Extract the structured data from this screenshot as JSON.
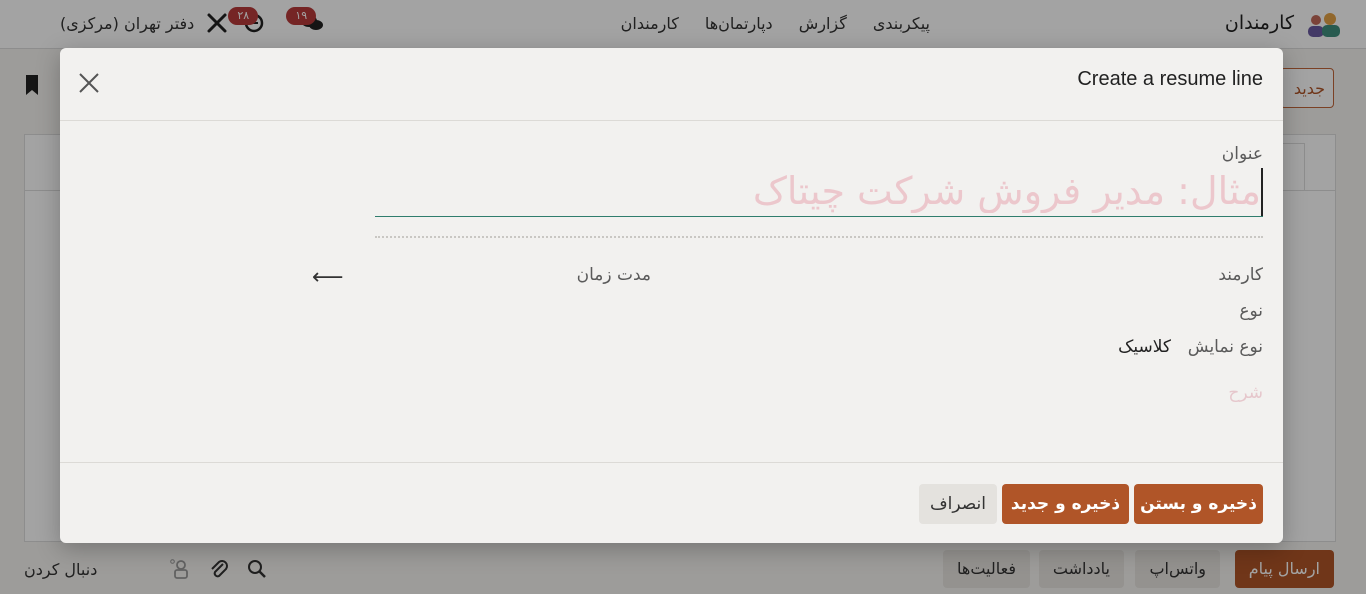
{
  "app": {
    "title": "کارمندان",
    "menu": [
      "کارمندان",
      "دپارتمان‌ها",
      "گزارش",
      "پیکربندی"
    ],
    "company": "دفتر تهران (مرکزی)",
    "messages_badge": "۱۹",
    "activities_badge": "۲۸",
    "new_button_label": "جدید",
    "brand_color": "#b05528"
  },
  "chatter": {
    "send_message": "ارسال پیام",
    "whatsapp": "واتس‌اپ",
    "note": "یادداشت",
    "activities": "فعالیت‌ها",
    "follow": "دنبال کردن"
  },
  "modal": {
    "title": "Create a resume line",
    "fields": {
      "title_label": "عنوان",
      "title_placeholder": "مثال: مدیر فروش شرکت چیتاک",
      "employee_label": "کارمند",
      "duration_label": "مدت زمان",
      "type_label": "نوع",
      "display_type_label": "نوع نمایش",
      "display_type_value": "کلاسیک",
      "description_placeholder": "شرح"
    },
    "buttons": {
      "save_close": "ذخیره و بستن",
      "save_new": "ذخیره و جدید",
      "discard": "انصراف"
    }
  }
}
